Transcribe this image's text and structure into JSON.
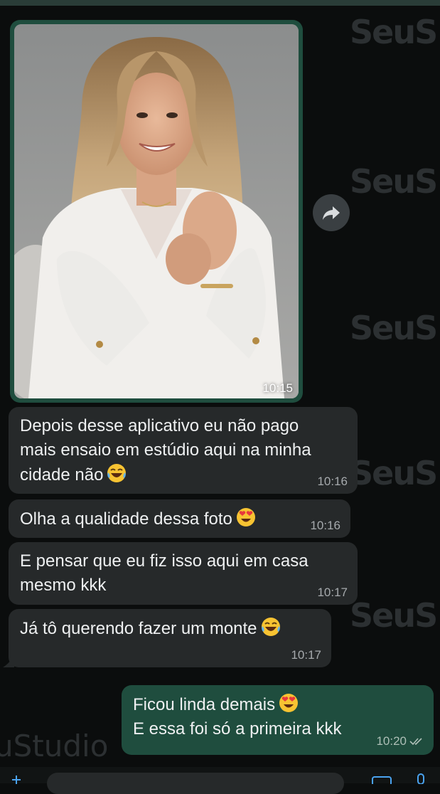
{
  "watermark": {
    "text": "SeuS",
    "bottom_text": "uStudio"
  },
  "chat": {
    "messages": [
      {
        "id": "img1",
        "direction": "incoming",
        "type": "image",
        "time": "10:15"
      },
      {
        "id": "m1",
        "direction": "incoming",
        "text": "Depois desse aplicativo eu não pago\nmais ensaio em estúdio aqui na minha\ncidade não",
        "emoji": "laughing-tears",
        "time": "10:16"
      },
      {
        "id": "m2",
        "direction": "incoming",
        "text": "Olha a qualidade dessa foto",
        "emoji": "heart-eyes",
        "time": "10:16"
      },
      {
        "id": "m3",
        "direction": "incoming",
        "text": "E pensar que eu fiz isso aqui em casa\nmesmo kkk",
        "time": "10:17"
      },
      {
        "id": "m4",
        "direction": "incoming",
        "text": "Já tô querendo fazer um monte",
        "emoji": "laughing-tears",
        "time": "10:17"
      },
      {
        "id": "m5",
        "direction": "outgoing",
        "line1": "Ficou linda demais",
        "line2": "E essa foi só a primeira kkk",
        "emoji": "heart-eyes",
        "time": "10:20",
        "status": "read"
      }
    ]
  },
  "colors": {
    "background": "#0b0d0d",
    "incoming_bubble": "#26292a",
    "outgoing_bubble": "#1f4d3e",
    "read_ticks": "#aebfb7"
  }
}
